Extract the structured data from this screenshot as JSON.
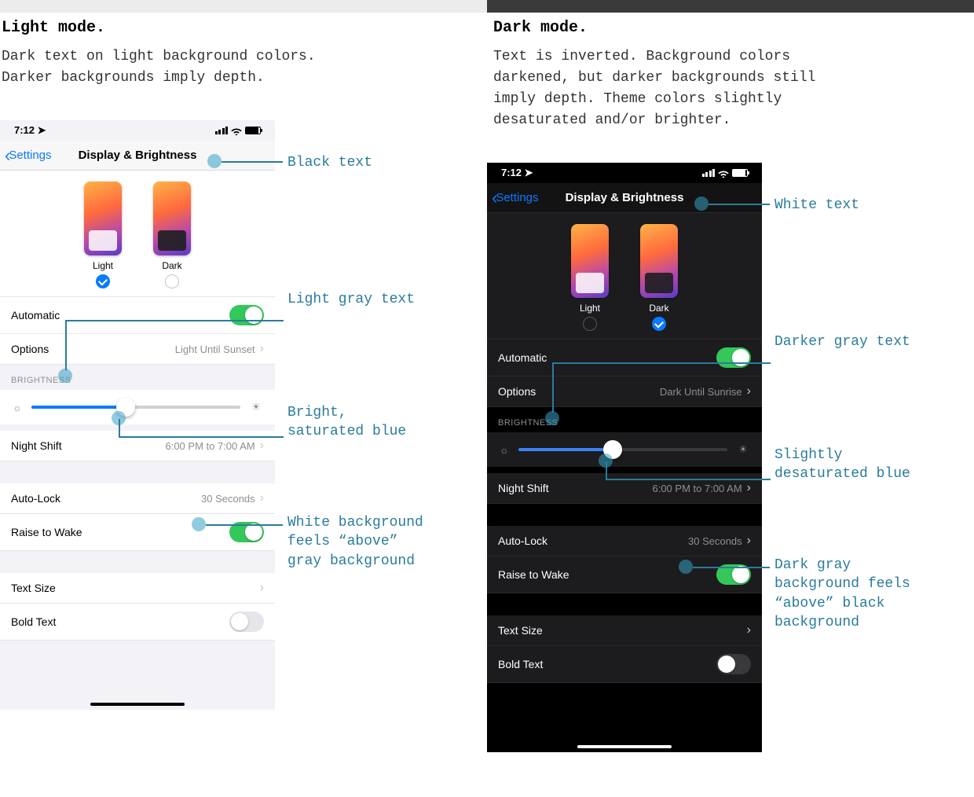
{
  "left": {
    "heading": "Light mode.",
    "desc": "Dark text on light background colors. Darker backgrounds imply depth.",
    "time": "7:12",
    "back": "Settings",
    "title": "Display & Brightness",
    "light_label": "Light",
    "dark_label": "Dark",
    "automatic": "Automatic",
    "options": "Options",
    "options_val": "Light Until Sunset",
    "brightness_hdr": "BRIGHTNESS",
    "night_shift": "Night Shift",
    "night_val": "6:00 PM to 7:00 AM",
    "auto_lock": "Auto-Lock",
    "auto_val": "30 Seconds",
    "raise": "Raise to Wake",
    "text_size": "Text Size",
    "bold_text": "Bold Text",
    "slider_pct": 45,
    "annot1": "Black text",
    "annot2": "Light gray text",
    "annot3": "Bright, saturated blue",
    "annot4": "White background feels “above” gray background"
  },
  "right": {
    "heading": "Dark mode.",
    "desc": "Text is inverted. Background colors darkened, but darker backgrounds still imply depth. Theme colors slightly desaturated and/or brighter.",
    "time": "7:12",
    "back": "Settings",
    "title": "Display & Brightness",
    "light_label": "Light",
    "dark_label": "Dark",
    "automatic": "Automatic",
    "options": "Options",
    "options_val": "Dark Until Sunrise",
    "brightness_hdr": "BRIGHTNESS",
    "night_shift": "Night Shift",
    "night_val": "6:00 PM to 7:00 AM",
    "auto_lock": "Auto-Lock",
    "auto_val": "30 Seconds",
    "raise": "Raise to Wake",
    "text_size": "Text Size",
    "bold_text": "Bold Text",
    "slider_pct": 45,
    "annot1": "White text",
    "annot2": "Darker gray text",
    "annot3": "Slightly desaturated blue",
    "annot4": "Dark gray background feels “above” black background"
  }
}
